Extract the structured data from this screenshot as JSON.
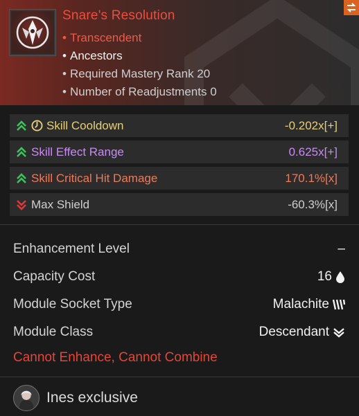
{
  "module": {
    "name": "Snare's Resolution",
    "tier": "Transcendent",
    "socket_type_name": "Ancestors",
    "mastery_label": "Required Mastery Rank 20",
    "readjust_label": "Number of Readjustments 0"
  },
  "stats": [
    {
      "name": "Skill Cooldown",
      "value": "-0.202x[+]",
      "direction": "up",
      "color": "#e6cf7a",
      "icon": "cooldown-icon"
    },
    {
      "name": "Skill Effect Range",
      "value": "0.625x[+]",
      "direction": "up",
      "color": "#c88cf0"
    },
    {
      "name": "Skill Critical Hit Damage",
      "value": "170.1%[x]",
      "direction": "up",
      "color": "#ef7a5a"
    },
    {
      "name": "Max Shield",
      "value": "-60.3%[x]",
      "direction": "down",
      "color": "#cfcfcf"
    }
  ],
  "details": {
    "enhancement_label": "Enhancement Level",
    "enhancement_value": "–",
    "capacity_label": "Capacity Cost",
    "capacity_value": "16",
    "socket_label": "Module Socket Type",
    "socket_value": "Malachite",
    "class_label": "Module Class",
    "class_value": "Descendant"
  },
  "restriction": "Cannot Enhance, Cannot Combine",
  "exclusive": "Ines exclusive",
  "colors": {
    "accent": "#ec4d3e",
    "header_red": "#7a2a22",
    "swap_button": "#d9631f",
    "up_arrow": "#3cc25a",
    "down_arrow": "#d63a3a"
  }
}
